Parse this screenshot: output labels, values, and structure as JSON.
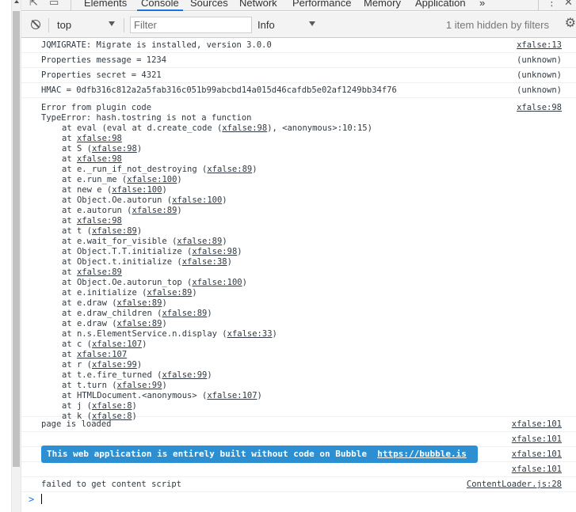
{
  "tabs": [
    "Elements",
    "Console",
    "Sources",
    "Network",
    "Performance",
    "Memory",
    "Application"
  ],
  "more_tabs": "»",
  "toolbar": {
    "context": "top",
    "filter_placeholder": "Filter",
    "level": "Info",
    "hidden_count": "1 item hidden by filters"
  },
  "icons": {
    "inspect": "inspect-icon",
    "device": "device-toolbar-icon",
    "menu": "kebab-menu-icon",
    "close": "close-icon",
    "clear": "clear-console-icon",
    "settings": "gear-icon"
  },
  "colors": {
    "tab_underline": "#1a73e8",
    "banner_bg": "#2b8fd1",
    "text": "#303942"
  },
  "messages": [
    {
      "text": "JQMIGRATE: Migrate is installed, version 3.0.0",
      "source": "xfalse:13",
      "source_link": true
    },
    {
      "text": "Properties message = 1234",
      "source": "(unknown)",
      "source_link": false
    },
    {
      "text": "Properties secret = 4321",
      "source": "(unknown)",
      "source_link": false
    },
    {
      "text": "HMAC = 0dfb316c812a2a5fab316c051b99abcbd14a015d46cafdb5e02af1249bb34f76",
      "source": "(unknown)",
      "source_link": false
    }
  ],
  "error": {
    "line1": "Error from plugin code",
    "line2": "TypeError: hash.tostring is not a function",
    "source": "xfalse:98",
    "stack": [
      {
        "pre": "at eval (eval at d.create_code (",
        "link": "xfalse:98",
        "post": "), <anonymous>:10:15)"
      },
      {
        "pre": "at ",
        "link": "xfalse:98",
        "post": ""
      },
      {
        "pre": "at S (",
        "link": "xfalse:98",
        "post": ")"
      },
      {
        "pre": "at ",
        "link": "xfalse:98",
        "post": ""
      },
      {
        "pre": "at e._run_if_not_destroying (",
        "link": "xfalse:89",
        "post": ")"
      },
      {
        "pre": "at e.run_me (",
        "link": "xfalse:100",
        "post": ")"
      },
      {
        "pre": "at new e (",
        "link": "xfalse:100",
        "post": ")"
      },
      {
        "pre": "at Object.Oe.autorun (",
        "link": "xfalse:100",
        "post": ")"
      },
      {
        "pre": "at e.autorun (",
        "link": "xfalse:89",
        "post": ")"
      },
      {
        "pre": "at ",
        "link": "xfalse:98",
        "post": ""
      },
      {
        "pre": "at t (",
        "link": "xfalse:89",
        "post": ")"
      },
      {
        "pre": "at e.wait_for_visible (",
        "link": "xfalse:89",
        "post": ")"
      },
      {
        "pre": "at Object.T.T.initialize (",
        "link": "xfalse:98",
        "post": ")"
      },
      {
        "pre": "at Object.t.initialize (",
        "link": "xfalse:38",
        "post": ")"
      },
      {
        "pre": "at ",
        "link": "xfalse:89",
        "post": ""
      },
      {
        "pre": "at Object.Oe.autorun_top (",
        "link": "xfalse:100",
        "post": ")"
      },
      {
        "pre": "at e.initialize (",
        "link": "xfalse:89",
        "post": ")"
      },
      {
        "pre": "at e.draw (",
        "link": "xfalse:89",
        "post": ")"
      },
      {
        "pre": "at e.draw_children (",
        "link": "xfalse:89",
        "post": ")"
      },
      {
        "pre": "at e.draw (",
        "link": "xfalse:89",
        "post": ")"
      },
      {
        "pre": "at n.s.ElementService.n.display (",
        "link": "xfalse:33",
        "post": ")"
      },
      {
        "pre": "at c (",
        "link": "xfalse:107",
        "post": ")"
      },
      {
        "pre": "at ",
        "link": "xfalse:107",
        "post": ""
      },
      {
        "pre": "at r (",
        "link": "xfalse:99",
        "post": ")"
      },
      {
        "pre": "at t.e.fire_turned (",
        "link": "xfalse:99",
        "post": ")"
      },
      {
        "pre": "at t.turn (",
        "link": "xfalse:99",
        "post": ")"
      },
      {
        "pre": "at HTMLDocument.<anonymous> (",
        "link": "xfalse:107",
        "post": ")"
      },
      {
        "pre": "at j (",
        "link": "xfalse:8",
        "post": ")"
      },
      {
        "pre": "at k (",
        "link": "xfalse:8",
        "post": ")"
      }
    ]
  },
  "after": {
    "loaded_text": "page is loaded",
    "loaded_source": "xfalse:101",
    "empty_source": "xfalse:101",
    "banner_text": "This web application is entirely built without code on Bubble",
    "banner_link": "https://bubble.is",
    "banner_source": "xfalse:101",
    "extra_source": "xfalse:101",
    "failed_text": "failed to get content script",
    "failed_source": "ContentLoader.js:28"
  },
  "prompt_symbol": ">"
}
